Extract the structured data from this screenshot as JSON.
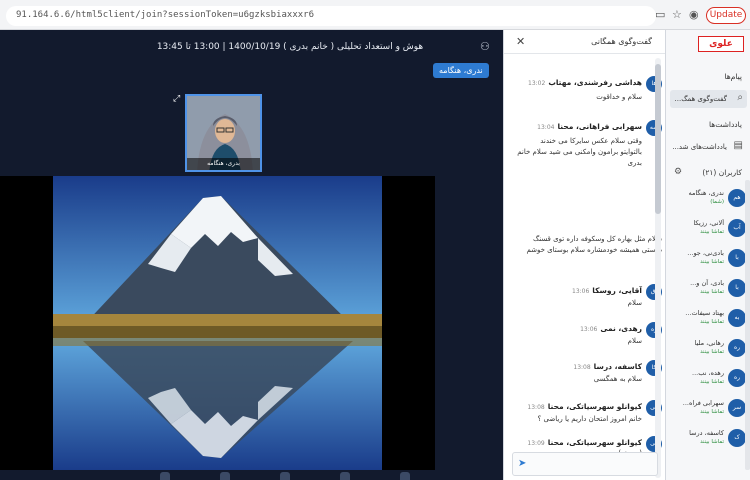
{
  "browser": {
    "url": "91.164.6.6/html5client/join?sessionToken=u6gzksbiaxxxr6",
    "update_label": "Update"
  },
  "video": {
    "session_title": "هوش و استعداد تحلیلی ( خانم بدری ) 1400/10/19 | 13:00 تا 13:45",
    "presenter_tag": "ندری، هنگامه",
    "webcam_label": "بدری، هنگامه"
  },
  "chat": {
    "title": "گفت‌وگوی همگانی",
    "messages": [
      {
        "avatar": "ها",
        "name": "هداشی رفرشندی، مهتاب",
        "time": "13:02",
        "text": "سلام و خداقوت"
      },
      {
        "avatar": "سه",
        "name": "سهرابی فراهانی، محنا",
        "time": "13:04",
        "text": "وقتی سلام عکس سایرکا می خندند بالتوایتو برامون وامکنی می شید سلام خانم بدری"
      },
      {
        "avatar": "",
        "name": "",
        "time": "",
        "text": "سلام مثل بهاره کل وسکوفه داره توی قسنگ دوستی همیشه خودمشاره سلام بوستای خوشم"
      },
      {
        "avatar": "آق",
        "name": "آقایی، روسکا",
        "time": "13:06",
        "text": "سلام"
      },
      {
        "avatar": "ره",
        "name": "رهدی، نمی",
        "time": "13:06",
        "text": "سلام"
      },
      {
        "avatar": "کا",
        "name": "کاسفه، درسا",
        "time": "13:08",
        "text": "سلام به همگسی"
      },
      {
        "avatar": "کی",
        "name": "کیوانلو سهرسیاتکی، محنا",
        "time": "13:08",
        "text": "خانم امروز امتحان داریم یا ریاضی ؟"
      },
      {
        "avatar": "کی",
        "name": "کیوانلو سهرسیاتکی، محنا",
        "time": "13:09",
        "text": "(جحونه)"
      }
    ]
  },
  "nav": {
    "logo": "علوی",
    "section_messages": "پیام‌ها",
    "public_chat": "گفت‌وگوی همگ...",
    "section_notes": "یادداشت‌ها",
    "shared_notes": "یادداشت‌های شد...",
    "users_header": "کاربران (۲۱)",
    "users": [
      {
        "avatar": "هم",
        "name": "ندری، هنگامه",
        "sub": "(شما)"
      },
      {
        "avatar": "آب",
        "name": "آلانی، رزیکا",
        "sub": "تماشا بینند"
      },
      {
        "avatar": "با",
        "name": "بادی‌نی، جو...",
        "sub": "تماشا بینند"
      },
      {
        "avatar": "با",
        "name": "بادی، آن و...",
        "sub": "تماشا بینند"
      },
      {
        "avatar": "به",
        "name": "بهتاد سیفات...",
        "sub": "تماشا بینند"
      },
      {
        "avatar": "ره",
        "name": "رهانی، ملیا",
        "sub": "تماشا بینند"
      },
      {
        "avatar": "ره",
        "name": "رهده، نب...",
        "sub": "تماشا بینند"
      },
      {
        "avatar": "سر",
        "name": "سهرابی فراه...",
        "sub": "تماشا بینند"
      },
      {
        "avatar": "ک",
        "name": "کاسفه، درسا",
        "sub": "تماشا بینند"
      }
    ]
  }
}
